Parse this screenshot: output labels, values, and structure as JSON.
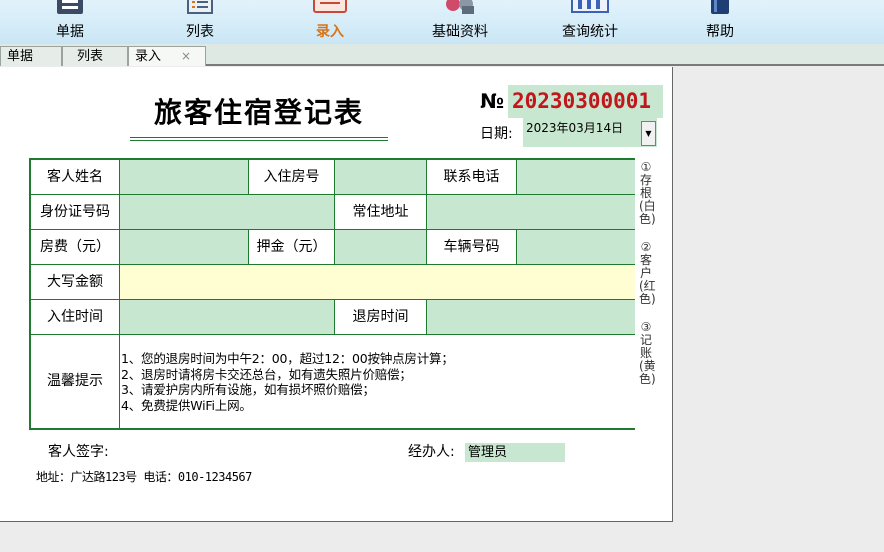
{
  "toolbar": {
    "items": [
      {
        "label": "单据",
        "icon": "document-icon"
      },
      {
        "label": "列表",
        "icon": "list-icon"
      },
      {
        "label": "录入",
        "icon": "entry-icon"
      },
      {
        "label": "基础资料",
        "icon": "users-icon"
      },
      {
        "label": "查询统计",
        "icon": "query-icon"
      },
      {
        "label": "帮助",
        "icon": "help-book-icon"
      }
    ],
    "active_color": "#d8741a"
  },
  "tabs": [
    {
      "label": "单据"
    },
    {
      "label": "列表"
    },
    {
      "label": "录入",
      "close": "×"
    }
  ],
  "form": {
    "title": "旅客住宿登记表",
    "no_sign": "№",
    "number": "20230300001",
    "date_label": "日期:",
    "date_value": "2023年03月14日",
    "labels": {
      "guest_name": "客人姓名",
      "room_no": "入住房号",
      "phone": "联系电话",
      "id_no": "身份证号码",
      "address": "常住地址",
      "room_fee": "房费（元）",
      "deposit": "押金（元）",
      "plate": "车辆号码",
      "amount_caps": "大写金额",
      "checkin_time": "入住时间",
      "checkout_time": "退房时间",
      "tips": "温馨提示"
    },
    "tips_text": "1、您的退房时间为中午2：00，超过12：00按钟点房计算；\n2、退房时请将房卡交还总台，如有遗失照片价赔偿；\n3、请爱护房内所有设施，如有损坏照价赔偿；\n4、免费提供WiFi上网。",
    "guest_signature_label": "客人签字:",
    "handler_label": "经办人:",
    "handler_value": "管理员",
    "footer": "地址：广达路123号   电话：010-1234567",
    "side_notes": [
      "①存根(白色)",
      "②客户(红色)",
      "③记账(黄色)"
    ]
  },
  "colors": {
    "input_green": "#c8e7d0",
    "border_green": "#1e7a2e",
    "number_red": "#c0161c",
    "amount_yellow": "#fefed2"
  }
}
